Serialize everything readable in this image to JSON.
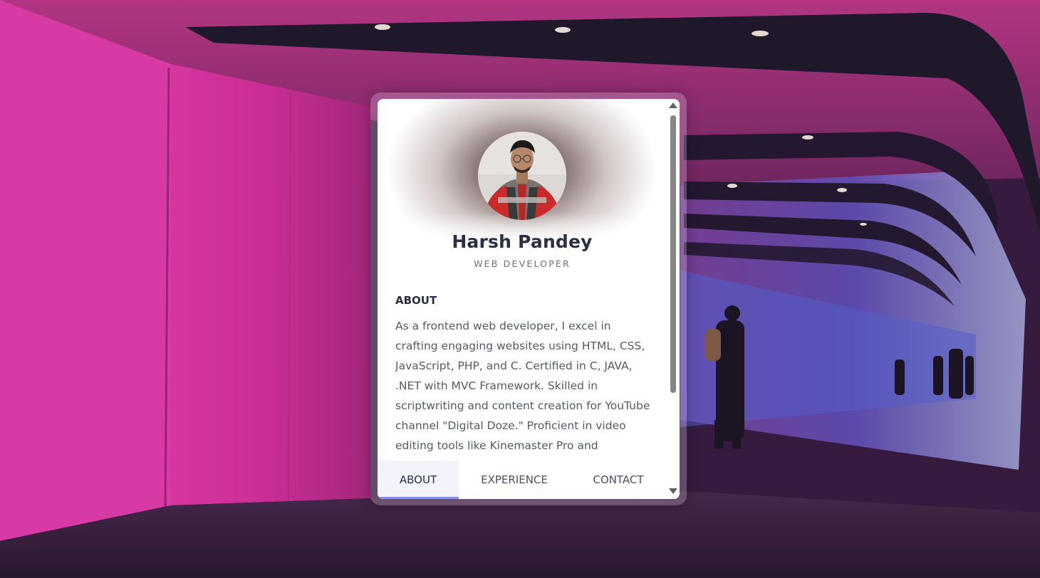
{
  "profile": {
    "name": "Harsh Pandey",
    "role": "WEB DEVELOPER",
    "avatar": "profile-photo"
  },
  "about": {
    "title": "ABOUT",
    "text": "As a frontend web developer, I excel in crafting engaging websites using HTML, CSS, JavaScript, PHP, and C. Certified in C, JAVA, .NET with MVC Framework. Skilled in scriptwriting and content creation for YouTube channel \"Digital Doze.\" Proficient in video editing tools like Kinemaster Pro and"
  },
  "tabs": [
    {
      "label": "ABOUT",
      "active": true
    },
    {
      "label": "EXPERIENCE",
      "active": false
    },
    {
      "label": "CONTACT",
      "active": false
    }
  ],
  "colors": {
    "accent": "#8a8fe6",
    "text_dark": "#2a2f45",
    "text_body": "#555a68",
    "background_pink": "#e0329e",
    "background_purple": "#3a1f45"
  },
  "icons": {
    "scroll_up": "triangle-up-icon",
    "scroll_down": "triangle-down-icon"
  }
}
